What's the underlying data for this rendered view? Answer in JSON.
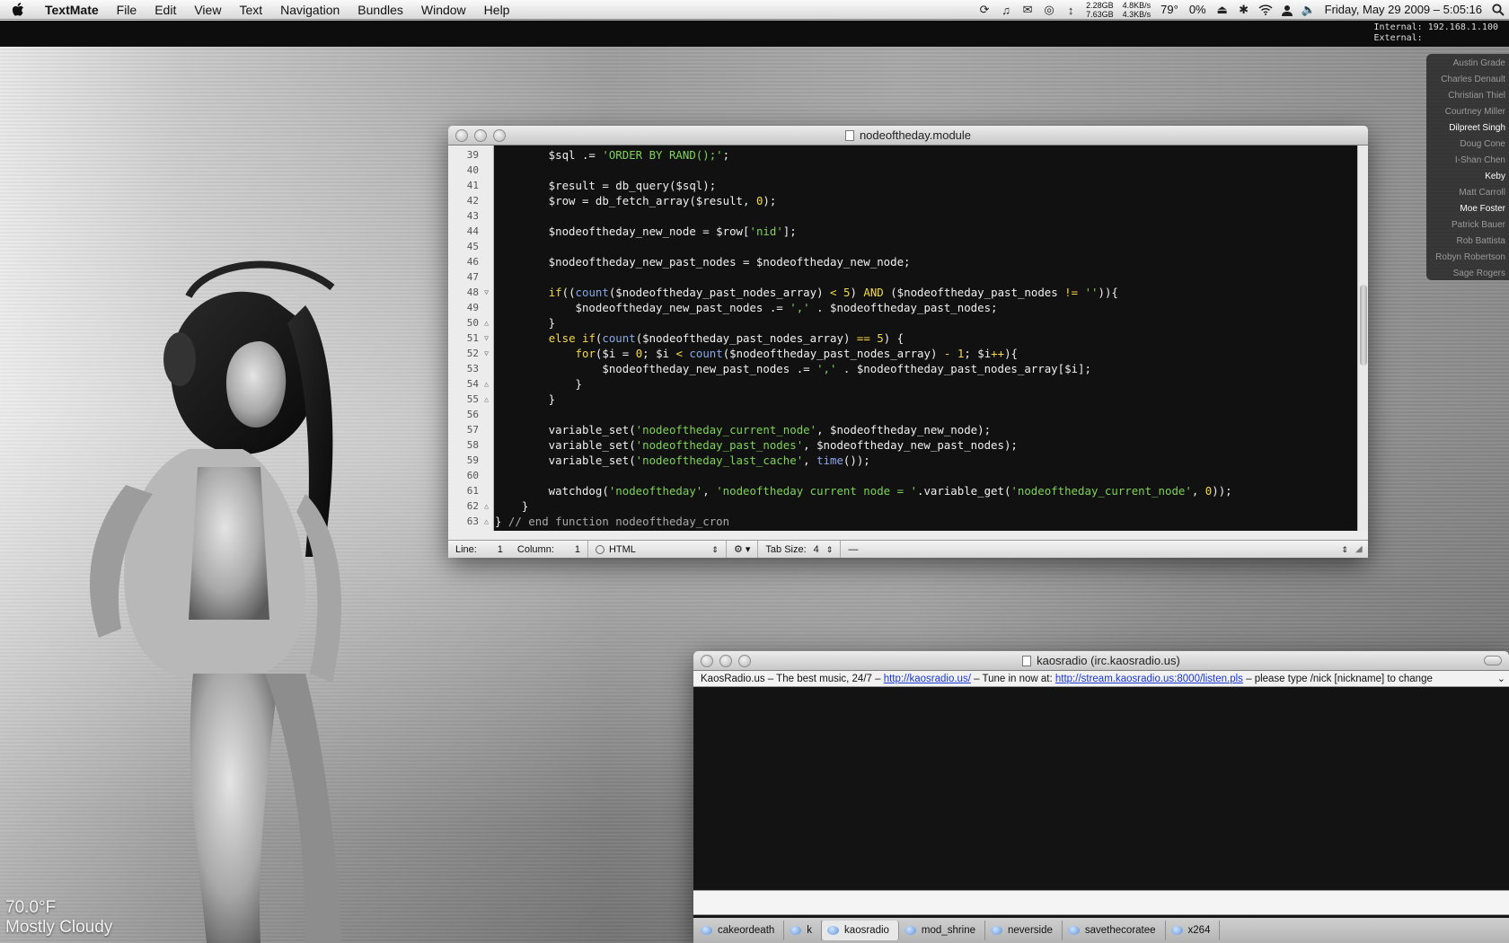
{
  "menubar": {
    "app_name": "TextMate",
    "menus": [
      "File",
      "Edit",
      "View",
      "Text",
      "Navigation",
      "Bundles",
      "Window",
      "Help"
    ],
    "disk": [
      "2.28GB",
      "7.63GB"
    ],
    "network": [
      "4.8KB/s",
      "4.3KB/s"
    ],
    "temperature": "79°",
    "cpu": "0%",
    "clock": "Friday, May 29 2009 – 5:05:16"
  },
  "ip_readout": {
    "internal": "Internal: 192.168.1.100",
    "external": "External:"
  },
  "buddies": [
    {
      "name": "Austin Grade",
      "online": false
    },
    {
      "name": "Charles Denault",
      "online": false
    },
    {
      "name": "Christian Thiel",
      "online": false
    },
    {
      "name": "Courtney Miller",
      "online": false
    },
    {
      "name": "Dilpreet Singh",
      "online": true
    },
    {
      "name": "Doug Cone",
      "online": false
    },
    {
      "name": "I-Shan Chen",
      "online": false
    },
    {
      "name": "Keby",
      "online": true
    },
    {
      "name": "Matt Carroll",
      "online": false
    },
    {
      "name": "Moe Foster",
      "online": true
    },
    {
      "name": "Patrick Bauer",
      "online": false
    },
    {
      "name": "Rob Battista",
      "online": false
    },
    {
      "name": "Robyn Robertson",
      "online": false
    },
    {
      "name": "Sage Rogers",
      "online": false
    }
  ],
  "textmate": {
    "title": "nodeoftheday.module",
    "lines": [
      {
        "n": "39",
        "fold": "",
        "html": "        $sql .= <span class=\"s\">'ORDER BY RAND();'</span>;"
      },
      {
        "n": "40",
        "fold": "",
        "html": ""
      },
      {
        "n": "41",
        "fold": "",
        "html": "        $result = db_query($sql);"
      },
      {
        "n": "42",
        "fold": "",
        "html": "        $row = db_fetch_array($result, <span class=\"n\">0</span>);"
      },
      {
        "n": "43",
        "fold": "",
        "html": ""
      },
      {
        "n": "44",
        "fold": "",
        "html": "        $nodeoftheday_new_node = $row[<span class=\"s\">'nid'</span>];"
      },
      {
        "n": "45",
        "fold": "",
        "html": ""
      },
      {
        "n": "46",
        "fold": "",
        "html": "        $nodeoftheday_new_past_nodes = $nodeoftheday_new_node;"
      },
      {
        "n": "47",
        "fold": "",
        "html": ""
      },
      {
        "n": "48",
        "fold": "▽",
        "html": "        <span class=\"k\">if</span>((<span class=\"f\">count</span>($nodeoftheday_past_nodes_array) <span class=\"k\">&lt;</span> <span class=\"n\">5</span>) <span class=\"k\">AND</span> ($nodeoftheday_past_nodes <span class=\"k\">!=</span> <span class=\"s\">''</span>)){"
      },
      {
        "n": "49",
        "fold": "",
        "html": "            $nodeoftheday_new_past_nodes .= <span class=\"s\">','</span> . $nodeoftheday_past_nodes;"
      },
      {
        "n": "50",
        "fold": "△",
        "html": "        }"
      },
      {
        "n": "51",
        "fold": "▽",
        "html": "        <span class=\"k\">else if</span>(<span class=\"f\">count</span>($nodeoftheday_past_nodes_array) <span class=\"k\">==</span> <span class=\"n\">5</span>) {"
      },
      {
        "n": "52",
        "fold": "▽",
        "html": "            <span class=\"k\">for</span>($i = <span class=\"n\">0</span>; $i <span class=\"k\">&lt;</span> <span class=\"f\">count</span>($nodeoftheday_past_nodes_array) <span class=\"k\">-</span> <span class=\"n\">1</span>; $i<span class=\"k\">++</span>){"
      },
      {
        "n": "53",
        "fold": "",
        "html": "                $nodeoftheday_new_past_nodes .= <span class=\"s\">','</span> . $nodeoftheday_past_nodes_array[$i];"
      },
      {
        "n": "54",
        "fold": "△",
        "html": "            }"
      },
      {
        "n": "55",
        "fold": "△",
        "html": "        }"
      },
      {
        "n": "56",
        "fold": "",
        "html": ""
      },
      {
        "n": "57",
        "fold": "",
        "html": "        variable_set(<span class=\"s\">'nodeoftheday_current_node'</span>, $nodeoftheday_new_node);"
      },
      {
        "n": "58",
        "fold": "",
        "html": "        variable_set(<span class=\"s\">'nodeoftheday_past_nodes'</span>, $nodeoftheday_new_past_nodes);"
      },
      {
        "n": "59",
        "fold": "",
        "html": "        variable_set(<span class=\"s\">'nodeoftheday_last_cache'</span>, <span class=\"f\">time</span>());"
      },
      {
        "n": "60",
        "fold": "",
        "html": ""
      },
      {
        "n": "61",
        "fold": "",
        "html": "        watchdog(<span class=\"s\">'nodeoftheday'</span>, <span class=\"s\">'nodeoftheday current node = '</span>.variable_get(<span class=\"s\">'nodeoftheday_current_node'</span>, <span class=\"n\">0</span>));"
      },
      {
        "n": "62",
        "fold": "△",
        "html": "    }"
      },
      {
        "n": "63",
        "fold": "△",
        "html": "} <span class=\"c\">// end function nodeoftheday_cron</span>"
      }
    ],
    "status": {
      "line_label": "Line:",
      "line": "1",
      "column_label": "Column:",
      "column": "1",
      "language": "HTML",
      "tab_size_label": "Tab Size:",
      "tab_size": "4",
      "symbol": "—"
    }
  },
  "irc": {
    "title": "kaosradio (irc.kaosradio.us)",
    "topic_prefix": "KaosRadio.us – The best music, 24/7 – ",
    "topic_link1": "http://kaosradio.us/",
    "topic_mid": " – Tune in now at: ",
    "topic_link2": "http://stream.kaosradio.us:8000/listen.pls",
    "topic_suffix": " – please type /nick [nickname] to change",
    "tabs": [
      "cakeordeath",
      "k",
      "kaosradio",
      "mod_shrine",
      "neverside",
      "savethecoratee",
      "x264"
    ],
    "active_tab": "kaosradio"
  },
  "weather": {
    "temperature": "70.0°F",
    "condition": "Mostly Cloudy"
  }
}
